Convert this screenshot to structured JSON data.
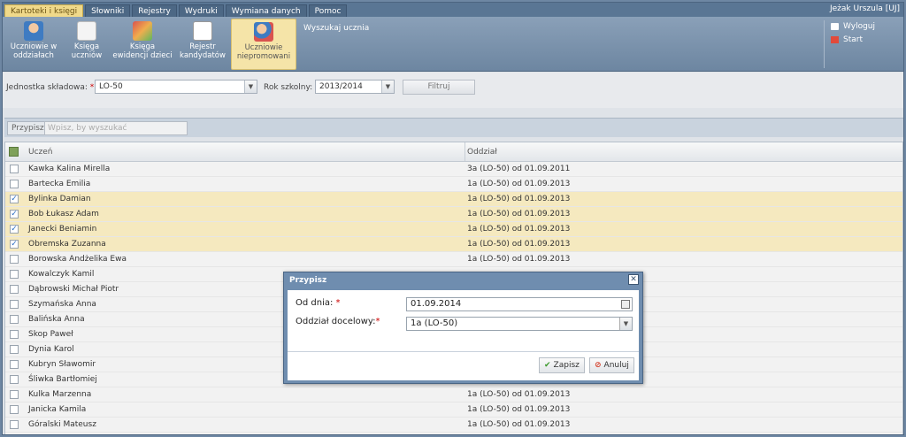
{
  "menu": {
    "tabs": [
      "Kartoteki i księgi",
      "Słowniki",
      "Rejestry",
      "Wydruki",
      "Wymiana danych",
      "Pomoc"
    ],
    "active_tab": "Kartoteki i księgi",
    "user": "Jeżak Urszula [UJ]"
  },
  "ribbon": {
    "buttons": [
      {
        "line1": "Uczniowie w",
        "line2": "oddziałach",
        "icon": "student-icon"
      },
      {
        "line1": "Księga",
        "line2": "uczniów",
        "icon": "book-icon"
      },
      {
        "line1": "Księga",
        "line2": "ewidencji dzieci",
        "icon": "children-book-icon"
      },
      {
        "line1": "Rejestr",
        "line2": "kandydatów",
        "icon": "candidates-register-icon"
      },
      {
        "line1": "Uczniowie",
        "line2": "niepromowani",
        "icon": "non-promoted-student-icon"
      }
    ],
    "search_label": "Wyszukaj ucznia",
    "logout": "Wyloguj",
    "start": "Start"
  },
  "filter": {
    "unit_label": "Jednostka składowa:",
    "unit_value": "LO-50",
    "year_label": "Rok szkolny:",
    "year_value": "2013/2014",
    "filter_button": "Filtruj"
  },
  "toolbar": {
    "assign_button": "Przypisz",
    "search_placeholder": "Wpisz, by wyszukać"
  },
  "grid": {
    "col_student": "Uczeń",
    "col_class": "Oddział",
    "rows": [
      {
        "name": "Kawka Kalina Mirella",
        "class": "3a (LO-50) od 01.09.2011",
        "checked": false
      },
      {
        "name": "Bartecka Emilia",
        "class": "1a (LO-50) od 01.09.2013",
        "checked": false
      },
      {
        "name": "Bylinka Damian",
        "class": "1a (LO-50) od 01.09.2013",
        "checked": true
      },
      {
        "name": "Bob Łukasz Adam",
        "class": "1a (LO-50) od 01.09.2013",
        "checked": true
      },
      {
        "name": "Janecki Beniamin",
        "class": "1a (LO-50) od 01.09.2013",
        "checked": true
      },
      {
        "name": "Obremska Zuzanna",
        "class": "1a (LO-50) od 01.09.2013",
        "checked": true
      },
      {
        "name": "Borowska Andżelika Ewa",
        "class": "1a (LO-50) od 01.09.2013",
        "checked": false
      },
      {
        "name": "Kowalczyk Kamil",
        "class": "",
        "checked": false
      },
      {
        "name": "Dąbrowski Michał Piotr",
        "class": "",
        "checked": false
      },
      {
        "name": "Szymańska Anna",
        "class": "",
        "checked": false
      },
      {
        "name": "Balińska Anna",
        "class": "",
        "checked": false
      },
      {
        "name": "Skop Paweł",
        "class": "",
        "checked": false
      },
      {
        "name": "Dynia Karol",
        "class": "",
        "checked": false
      },
      {
        "name": "Kubryn Sławomir",
        "class": "",
        "checked": false
      },
      {
        "name": "Śliwka Bartłomiej",
        "class": "",
        "checked": false
      },
      {
        "name": "Kulka Marzenna",
        "class": "1a (LO-50) od 01.09.2013",
        "checked": false
      },
      {
        "name": "Janicka Kamila",
        "class": "1a (LO-50) od 01.09.2013",
        "checked": false
      },
      {
        "name": "Góralski Mateusz",
        "class": "1a (LO-50) od 01.09.2013",
        "checked": false
      }
    ]
  },
  "dialog": {
    "title": "Przypisz",
    "date_label": "Od dnia:",
    "date_value": "01.09.2014",
    "class_label": "Oddział docelowy:",
    "class_value": "1a (LO-50)",
    "save": "Zapisz",
    "cancel": "Anuluj"
  },
  "colors": {
    "selected_row": "#f5e9bf",
    "active_tab": "#f0d98a",
    "dialog_frame": "#6f8daf"
  }
}
